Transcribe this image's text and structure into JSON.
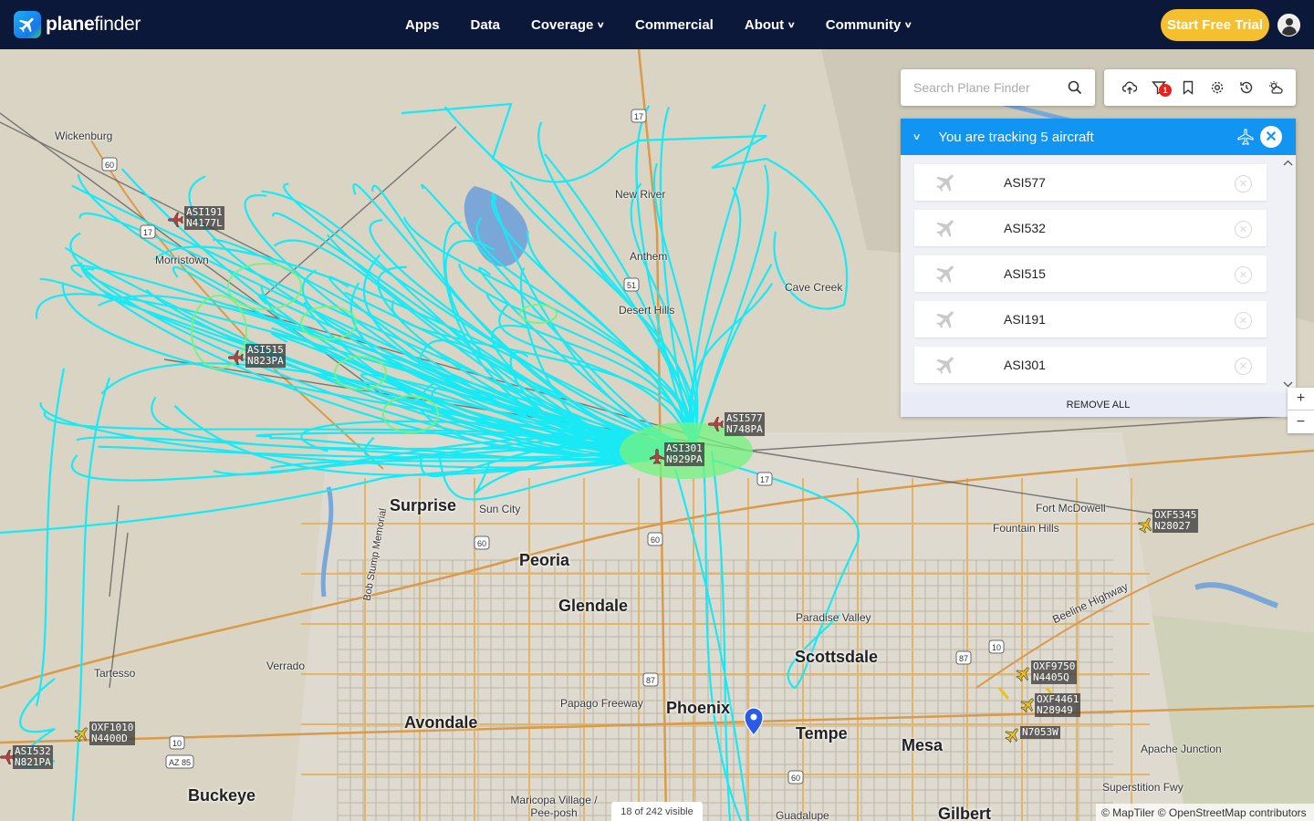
{
  "brand": {
    "name_bold": "plane",
    "name_rest": "finder"
  },
  "nav": {
    "items": [
      {
        "label": "Apps",
        "caret": false
      },
      {
        "label": "Data",
        "caret": false
      },
      {
        "label": "Coverage",
        "caret": true
      },
      {
        "label": "Commercial",
        "caret": false
      },
      {
        "label": "About",
        "caret": true
      },
      {
        "label": "Community",
        "caret": true
      }
    ],
    "cta": "Start Free Trial"
  },
  "search": {
    "placeholder": "Search Plane Finder"
  },
  "toolbar": {
    "filter_badge": "1"
  },
  "tracker": {
    "title": "You are tracking 5 aircraft",
    "aircraft": [
      "ASI577",
      "ASI532",
      "ASI515",
      "ASI191",
      "ASI301"
    ],
    "remove_all": "REMOVE ALL"
  },
  "zoom": {
    "in": "+",
    "out": "−"
  },
  "map": {
    "towns": [
      "Wickenburg",
      "New River",
      "Anthem",
      "Cave Creek",
      "Desert Hills",
      "Morristown",
      "Sun City",
      "Fort McDowell",
      "Fountain Hills",
      "Paradise Valley",
      "Verrado",
      "Tartesso",
      "Papago Freeway",
      "Maricopa Village / Pee-posh",
      "Guadalupe",
      "Apache Junction",
      "Superstition Fwy",
      "Beeline Highway",
      "Bob Stump Memorial"
    ],
    "cities": [
      "Surprise",
      "Peoria",
      "Glendale",
      "Phoenix",
      "Scottsdale",
      "Tempe",
      "Mesa",
      "Avondale",
      "Buckeye",
      "Gilbert"
    ],
    "aircraft": [
      {
        "callsign": "ASI191",
        "reg": "N4177L"
      },
      {
        "callsign": "ASI515",
        "reg": "N823PA"
      },
      {
        "callsign": "ASI577",
        "reg": "N748PA"
      },
      {
        "callsign": "ASI301",
        "reg": "N929PA"
      },
      {
        "callsign": "OXF5345",
        "reg": "N28027"
      },
      {
        "callsign": "OXF9750",
        "reg": "N4405Q"
      },
      {
        "callsign": "OXF4461",
        "reg": "N28949"
      },
      {
        "callsign": "",
        "reg": "N7053W"
      },
      {
        "callsign": "OXF1010",
        "reg": "N4400D"
      },
      {
        "callsign": "ASI532",
        "reg": "N821PA"
      }
    ],
    "shields": [
      "17",
      "60",
      "17",
      "51",
      "17",
      "60",
      "60",
      "87",
      "87",
      "10",
      "10",
      "AZ 85",
      "60"
    ]
  },
  "status": {
    "visible": "18 of 242 visible",
    "attribution": "© MapTiler © OpenStreetMap contributors"
  },
  "colors": {
    "nav_bg": "#0c1839",
    "cta": "#f5c030",
    "track": "#19e9f5",
    "track_green": "#74f27e",
    "tracker_header": "#1294f2",
    "badge": "#e8211d"
  }
}
